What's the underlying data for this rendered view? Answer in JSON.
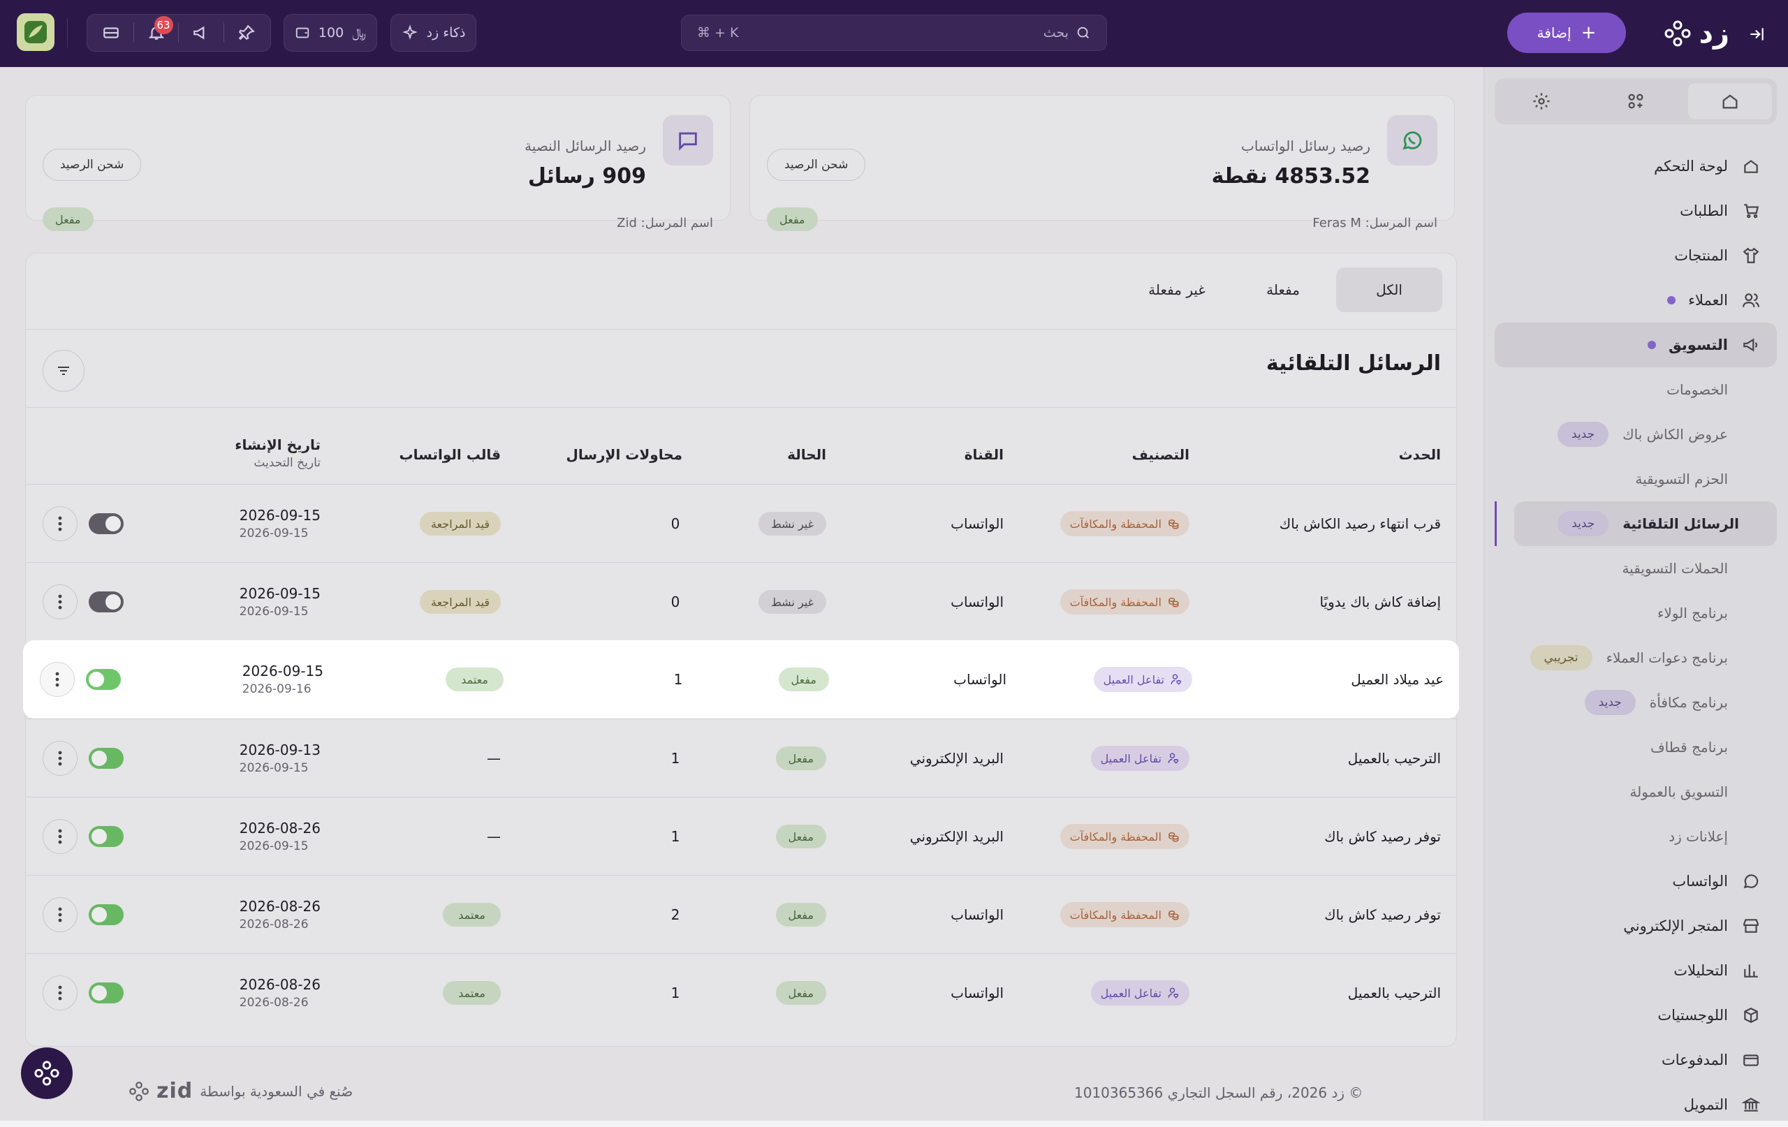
{
  "topbar": {
    "brand": "زد",
    "add_label": "إضافة",
    "search_label": "بحث",
    "search_shortcut": "⌘ + K",
    "notifications_count": "63",
    "wallet_value": "100",
    "ai_label": "ذكاء زد"
  },
  "sidebar": {
    "tabs": [
      "home-icon",
      "apps-icon",
      "settings-icon"
    ],
    "items": {
      "dashboard": "لوحة التحكم",
      "orders": "الطلبات",
      "products": "المنتجات",
      "customers": "العملاء",
      "marketing": "التسويق",
      "whatsapp": "الواتساب",
      "store": "المتجر الإلكتروني",
      "analytics": "التحليلات",
      "logistics": "اللوجستيات",
      "payments": "المدفوعات",
      "financing": "التمويل"
    },
    "sub": {
      "discounts": "الخصومات",
      "cashback": "عروض الكاش باك",
      "bundles": "الحزم التسويقية",
      "auto_messages": "الرسائل التلقائية",
      "campaigns": "الحملات التسويقية",
      "loyalty": "برنامج الولاء",
      "referral": "برنامج دعوات العملاء",
      "rewards": "برنامج مكافأة",
      "qitaf": "برنامج قطاف",
      "affiliate": "التسويق بالعمولة",
      "ads": "إعلانات زد"
    },
    "badge_new": "جديد",
    "badge_trial": "تجريبي"
  },
  "balances": {
    "whatsapp": {
      "title": "رصيد رسائل الواتساب",
      "value": "4853.52 نقطة",
      "sender": "اسم المرسل: Feras M",
      "charge": "شحن الرصيد",
      "status": "مفعل"
    },
    "sms": {
      "title": "رصيد الرسائل النصية",
      "value": "909 رسائل",
      "sender": "اسم المرسل: Zid",
      "charge": "شحن الرصيد",
      "status": "مفعل"
    }
  },
  "list": {
    "tabs": [
      "الكل",
      "مفعلة",
      "غير مفعلة"
    ],
    "title": "الرسائل التلقائية",
    "headers": {
      "event": "الحدث",
      "category": "التصنيف",
      "channel": "القناة",
      "status": "الحالة",
      "attempts": "محاولات الإرسال",
      "template": "قالب الواتساب",
      "created": "تاريخ الإنشاء",
      "updated": "تاريخ التحديث"
    },
    "rows": [
      {
        "event": "قرب انتهاء رصيد الكاش باك",
        "category": "المحفظة والمكافآت",
        "channel": "الواتساب",
        "status": "غير نشط",
        "attempts": "0",
        "template": "قيد المراجعة",
        "created": "2026-09-15",
        "updated": "2026-09-15"
      },
      {
        "event": "إضافة كاش باك يدويًا",
        "category": "المحفظة والمكافآت",
        "channel": "الواتساب",
        "status": "غير نشط",
        "attempts": "0",
        "template": "قيد المراجعة",
        "created": "2026-09-15",
        "updated": "2026-09-15"
      },
      {
        "event": "عيد ميلاد العميل",
        "category": "تفاعل العميل",
        "channel": "الواتساب",
        "status": "مفعل",
        "attempts": "1",
        "template": "معتمد",
        "created": "2026-09-15",
        "updated": "2026-09-16"
      },
      {
        "event": "الترحيب بالعميل",
        "category": "تفاعل العميل",
        "channel": "البريد الإلكتروني",
        "status": "مفعل",
        "attempts": "1",
        "template": "—",
        "created": "2026-09-13",
        "updated": "2026-09-15"
      },
      {
        "event": "توفر رصيد كاش باك",
        "category": "المحفظة والمكافآت",
        "channel": "البريد الإلكتروني",
        "status": "مفعل",
        "attempts": "1",
        "template": "—",
        "created": "2026-08-26",
        "updated": "2026-09-15"
      },
      {
        "event": "توفر رصيد كاش باك",
        "category": "المحفظة والمكافآت",
        "channel": "الواتساب",
        "status": "مفعل",
        "attempts": "2",
        "template": "معتمد",
        "created": "2026-08-26",
        "updated": "2026-08-26"
      },
      {
        "event": "الترحيب بالعميل",
        "category": "تفاعل العميل",
        "channel": "الواتساب",
        "status": "مفعل",
        "attempts": "1",
        "template": "معتمد",
        "created": "2026-08-26",
        "updated": "2026-08-26"
      }
    ]
  },
  "footer": {
    "copyright": "© زد 2026، رقم السجل التجاري 1010365366",
    "made_in": "صُنع في السعودية بواسطة",
    "zid_mark": "zid"
  },
  "colors": {
    "topbar": "#2b1848",
    "accent": "#7b4fc4",
    "active_green": "#6fc66a"
  }
}
